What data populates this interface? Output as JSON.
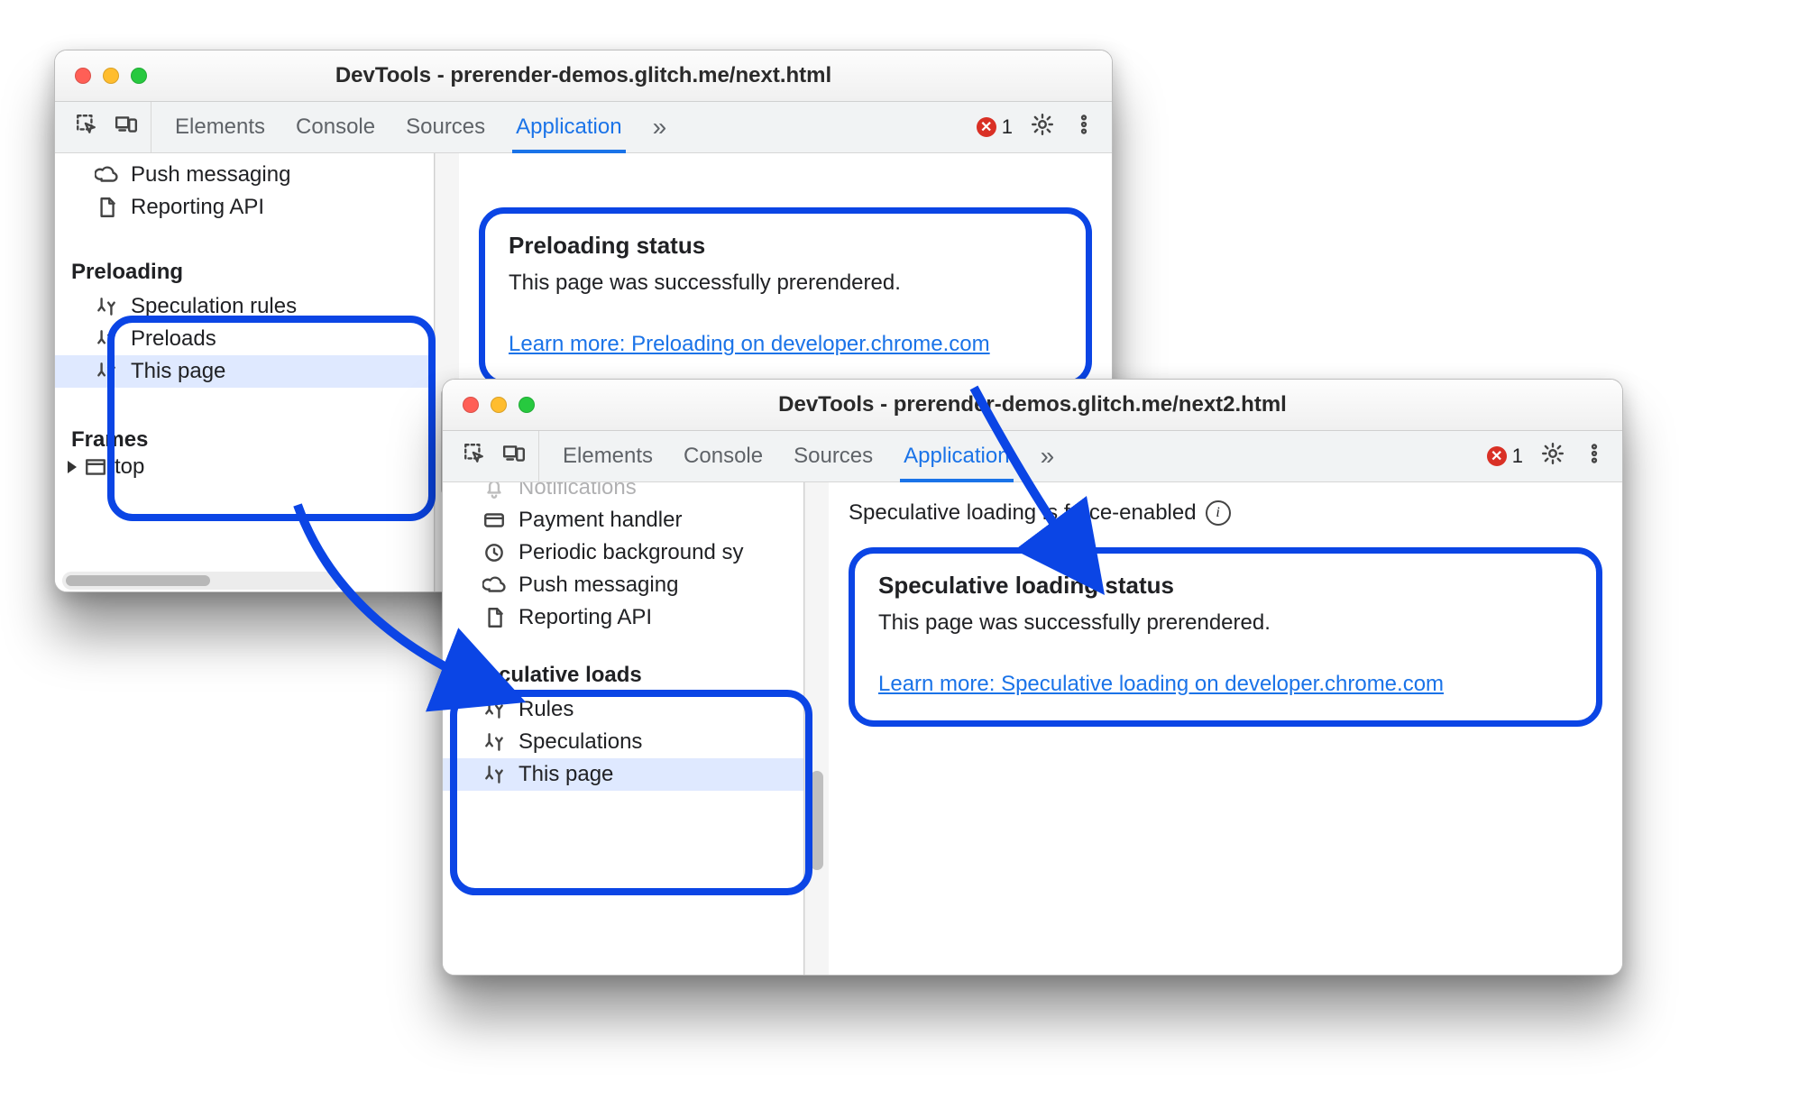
{
  "windows": {
    "old": {
      "title": "DevTools - prerender-demos.glitch.me/next.html",
      "tabs": {
        "elements": "Elements",
        "console": "Console",
        "sources": "Sources",
        "application": "Application",
        "active": "Application"
      },
      "errors_count": "1",
      "sidebar": {
        "above": [
          {
            "icon": "cloud",
            "label": "Push messaging"
          },
          {
            "icon": "doc",
            "label": "Reporting API"
          }
        ],
        "section_title": "Preloading",
        "items": [
          {
            "label": "Speculation rules",
            "selected": false
          },
          {
            "label": "Preloads",
            "selected": false
          },
          {
            "label": "This page",
            "selected": true
          }
        ],
        "frames_title": "Frames",
        "frames_top": "top"
      },
      "panel": {
        "heading": "Preloading status",
        "body": "This page was successfully prerendered.",
        "link_text": "Learn more: Preloading on developer.chrome.com"
      }
    },
    "new": {
      "title": "DevTools - prerender-demos.glitch.me/next2.html",
      "tabs": {
        "elements": "Elements",
        "console": "Console",
        "sources": "Sources",
        "application": "Application",
        "active": "Application"
      },
      "errors_count": "1",
      "sidebar": {
        "above": [
          {
            "icon": "bell",
            "label": "Notifications",
            "faded": true
          },
          {
            "icon": "card",
            "label": "Payment handler"
          },
          {
            "icon": "clock",
            "label": "Periodic background sy"
          },
          {
            "icon": "cloud",
            "label": "Push messaging"
          },
          {
            "icon": "doc",
            "label": "Reporting API"
          }
        ],
        "section_title": "Speculative loads",
        "items": [
          {
            "label": "Rules",
            "selected": false
          },
          {
            "label": "Speculations",
            "selected": false
          },
          {
            "label": "This page",
            "selected": true
          }
        ]
      },
      "status_line": "Speculative loading is force-enabled",
      "panel": {
        "heading": "Speculative loading status",
        "body": "This page was successfully prerendered.",
        "link_text": "Learn more: Speculative loading on developer.chrome.com"
      }
    }
  }
}
